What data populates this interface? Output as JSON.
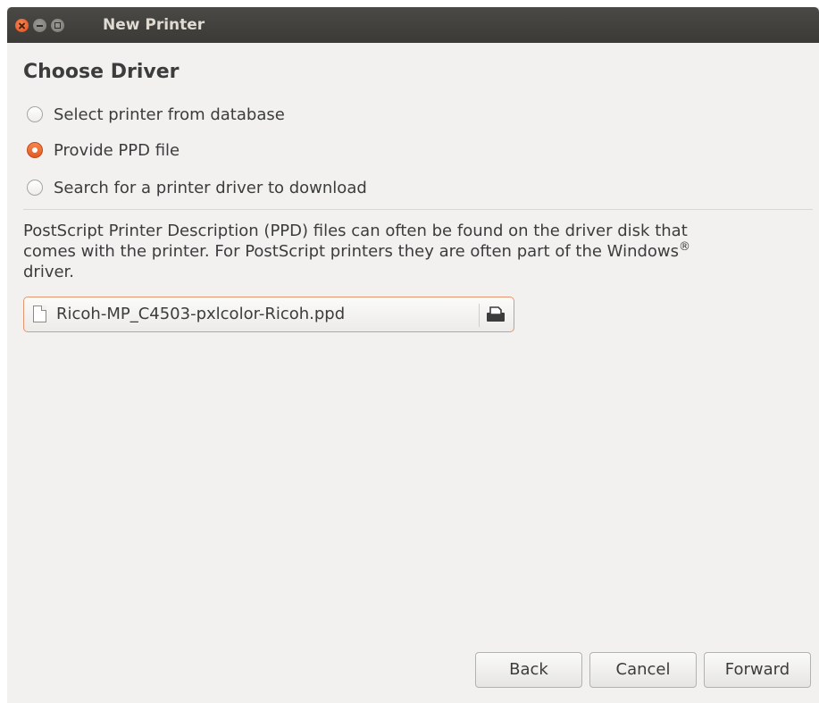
{
  "window": {
    "title": "New Printer",
    "controls": [
      "close-icon",
      "minimize-icon",
      "maximize-icon"
    ]
  },
  "page": {
    "heading": "Choose Driver"
  },
  "options": [
    {
      "label": "Select printer from database",
      "checked": false
    },
    {
      "label": "Provide PPD file",
      "checked": true
    },
    {
      "label": "Search for a printer driver to download",
      "checked": false
    }
  ],
  "description": {
    "line1": "PostScript Printer Description (PPD) files can often be found on the driver disk that",
    "line2": "comes with the printer. For PostScript printers they are often part of the Windows",
    "registered": "®",
    "line3": "driver."
  },
  "file_chooser": {
    "value": "Ricoh-MP_C4503-pxlcolor-Ricoh.ppd",
    "icons": [
      "document-icon",
      "open-file-icon"
    ]
  },
  "buttons": {
    "back": "Back",
    "cancel": "Cancel",
    "forward": "Forward"
  },
  "colors": {
    "accent": "#e25a24",
    "titlebar": "#3c3b37",
    "background": "#f2f1f0"
  }
}
